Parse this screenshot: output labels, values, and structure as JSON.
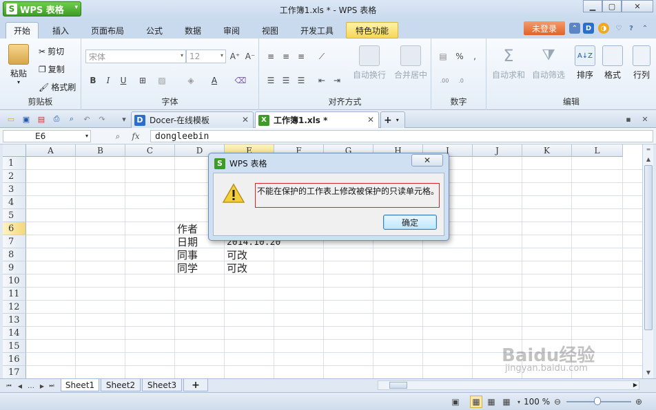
{
  "app": {
    "name": "WPS 表格",
    "logo": "S"
  },
  "window": {
    "title": "工作簿1.xls * - WPS 表格"
  },
  "tabs": [
    "开始",
    "插入",
    "页面布局",
    "公式",
    "数据",
    "审阅",
    "视图",
    "开发工具",
    "特色功能"
  ],
  "login_label": "未登录",
  "ribbon": {
    "clipboard": {
      "paste": "粘贴",
      "cut": "剪切",
      "copy": "复制",
      "format_painter": "格式刷",
      "label": "剪贴板"
    },
    "font": {
      "name": "宋体",
      "size": "12",
      "bold": "B",
      "italic": "I",
      "underline": "U",
      "label": "字体"
    },
    "align": {
      "wrap": "自动换行",
      "merge": "合并居中",
      "label": "对齐方式"
    },
    "number": {
      "percent": "%",
      "label": "数字"
    },
    "edit": {
      "autosum": "自动求和",
      "autofilter": "自动筛选",
      "sort": "排序",
      "format": "格式",
      "rowcol": "行列",
      "label": "编辑"
    }
  },
  "doc_tabs": [
    {
      "label": "Docer-在线模板",
      "icon": "D"
    },
    {
      "label": "工作簿1.xls *",
      "icon": "X"
    }
  ],
  "formula_bar": {
    "cell_ref": "E6",
    "fx": "fx",
    "content": "dongleebin"
  },
  "columns": [
    "A",
    "B",
    "C",
    "D",
    "E",
    "F",
    "G",
    "H",
    "I",
    "J",
    "K",
    "L"
  ],
  "rows": [
    "1",
    "2",
    "3",
    "4",
    "5",
    "6",
    "7",
    "8",
    "9",
    "10",
    "11",
    "12",
    "13",
    "14",
    "15",
    "16",
    "17"
  ],
  "cells": {
    "d6": "作者",
    "d7": "日期",
    "e7": "2014.10.20",
    "d8": "同事",
    "e8": "可改",
    "d9": "同学",
    "e9": "可改"
  },
  "sheets": [
    "Sheet1",
    "Sheet2",
    "Sheet3"
  ],
  "status": {
    "zoom": "100 %"
  },
  "dialog": {
    "title": "WPS 表格",
    "message": "不能在保护的工作表上修改被保护的只读单元格。",
    "ok": "确定",
    "close": "关闭"
  },
  "watermark": {
    "text": "Baidu经验",
    "url": "jingyan.baidu.com"
  },
  "colors": {
    "accent": "#3d9c25",
    "selected_header": "#f4d77a",
    "dialog_border": "#d42424"
  }
}
